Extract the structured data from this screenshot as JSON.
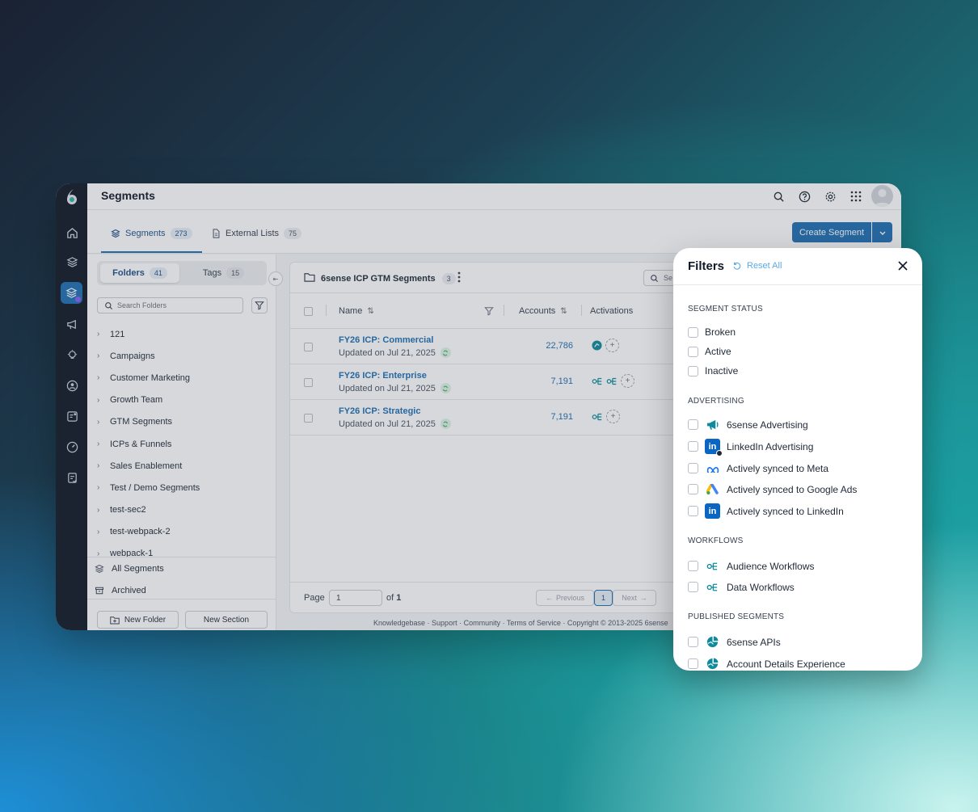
{
  "header": {
    "title": "Segments"
  },
  "tabs": [
    {
      "label": "Segments",
      "count": "273"
    },
    {
      "label": "External Lists",
      "count": "75"
    }
  ],
  "create_button": "Create Segment",
  "left_panel": {
    "toggle": [
      {
        "label": "Folders",
        "count": "41"
      },
      {
        "label": "Tags",
        "count": "15"
      }
    ],
    "search_placeholder": "Search Folders",
    "folders": [
      "121",
      "Campaigns",
      "Customer Marketing",
      "Growth Team",
      "GTM Segments",
      "ICPs & Funnels",
      "Sales Enablement",
      "Test / Demo Segments",
      "test-sec2",
      "test-webpack-2",
      "webpack-1"
    ],
    "all_segments": "All Segments",
    "archived": "Archived",
    "new_folder": "New Folder",
    "new_section": "New Section"
  },
  "content": {
    "folder_name": "6sense ICP GTM Segments",
    "folder_count": "3",
    "search_placeholder": "Se",
    "columns": {
      "name": "Name",
      "accounts": "Accounts",
      "activations": "Activations"
    },
    "rows": [
      {
        "name": "FY26 ICP: Commercial",
        "updated": "Updated on Jul 21, 2025",
        "accounts": "22,786"
      },
      {
        "name": "FY26 ICP: Enterprise",
        "updated": "Updated on Jul 21, 2025",
        "accounts": "7,191"
      },
      {
        "name": "FY26 ICP: Strategic",
        "updated": "Updated on Jul 21, 2025",
        "accounts": "7,191"
      }
    ],
    "pager": {
      "page_label": "Page",
      "page_value": "1",
      "of_label": "of",
      "total_pages": "1",
      "previous": "Previous",
      "next": "Next",
      "current": "1"
    }
  },
  "footer": "Knowledgebase · Support · Community · Terms of Service · Copyright © 2013-2025 6sense",
  "filters": {
    "title": "Filters",
    "reset": "Reset All",
    "segment_status": {
      "heading": "SEGMENT STATUS",
      "items": [
        "Broken",
        "Active",
        "Inactive"
      ]
    },
    "advertising": {
      "heading": "ADVERTISING",
      "items": [
        "6sense Advertising",
        "LinkedIn Advertising",
        "Actively synced to Meta",
        "Actively synced to Google Ads",
        "Actively synced to LinkedIn"
      ]
    },
    "workflows": {
      "heading": "WORKFLOWS",
      "items": [
        "Audience Workflows",
        "Data Workflows"
      ]
    },
    "published": {
      "heading": "PUBLISHED SEGMENTS",
      "items": [
        "6sense APIs",
        "Account Details Experience"
      ]
    },
    "linkedin_glyph": "in"
  },
  "colors": {
    "primary": "#1f6fb2",
    "rail": "#101826",
    "reset": "#5aa9e6",
    "linkedin": "#0a66c2"
  }
}
